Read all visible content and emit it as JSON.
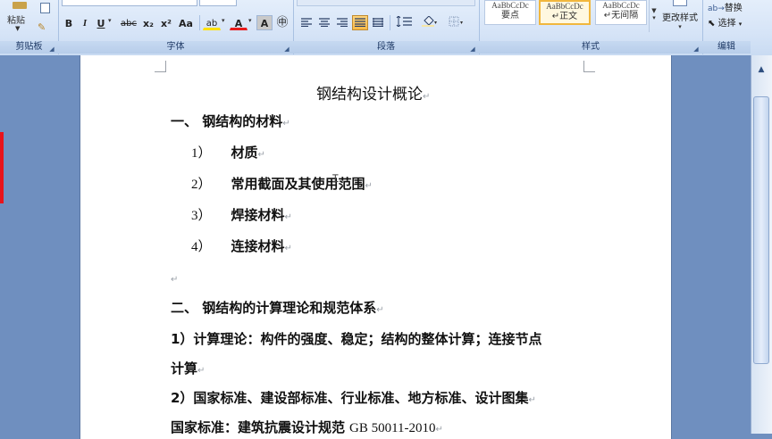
{
  "ribbon": {
    "clipboard": {
      "paste_label": "粘贴",
      "group_label": "剪贴板"
    },
    "font": {
      "group_label": "字体",
      "bold": "B",
      "italic": "I",
      "underline": "U",
      "strike": "abc",
      "subscript": "x₂",
      "superscript": "x²",
      "change_case": "Aa",
      "highlight": "ab",
      "font_color": "A",
      "char_border": "A",
      "enclose": "㊥"
    },
    "paragraph": {
      "group_label": "段落"
    },
    "styles": {
      "group_label": "样式",
      "cards": [
        {
          "preview": "AaBbCcDc",
          "name": "要点",
          "selected": false
        },
        {
          "preview": "AaBbCcDc",
          "name": "↵正文",
          "selected": true
        },
        {
          "preview": "AaBbCcDc",
          "name": "↵无间隔",
          "selected": false
        }
      ],
      "change_styles": "更改样式"
    },
    "editing": {
      "group_label": "编辑",
      "replace": "替换",
      "select": "选择"
    }
  },
  "document": {
    "title": "钢结构设计概论",
    "heading1": "一、 钢结构的材料",
    "items1": [
      {
        "num": "1）",
        "text": "材质"
      },
      {
        "num": "2）",
        "text": "常用截面及其使用范围"
      },
      {
        "num": "3）",
        "text": "焊接材料"
      },
      {
        "num": "4）",
        "text": "连接材料"
      }
    ],
    "heading2": "二、 钢结构的计算理论和规范体系",
    "para1_line1": "1）计算理论：构件的强度、稳定；结构的整体计算；连接节点",
    "para1_line2": "计算",
    "para2": "2）国家标准、建设部标准、行业标准、地方标准、设计图集",
    "para3_prefix": "国家标准：建筑抗震设计规范",
    "para3_code": "GB 50011-2010"
  },
  "colors": {
    "accent": "#f1b73d",
    "page_bg": "#ffffff",
    "workspace": "#6f8fbf"
  }
}
